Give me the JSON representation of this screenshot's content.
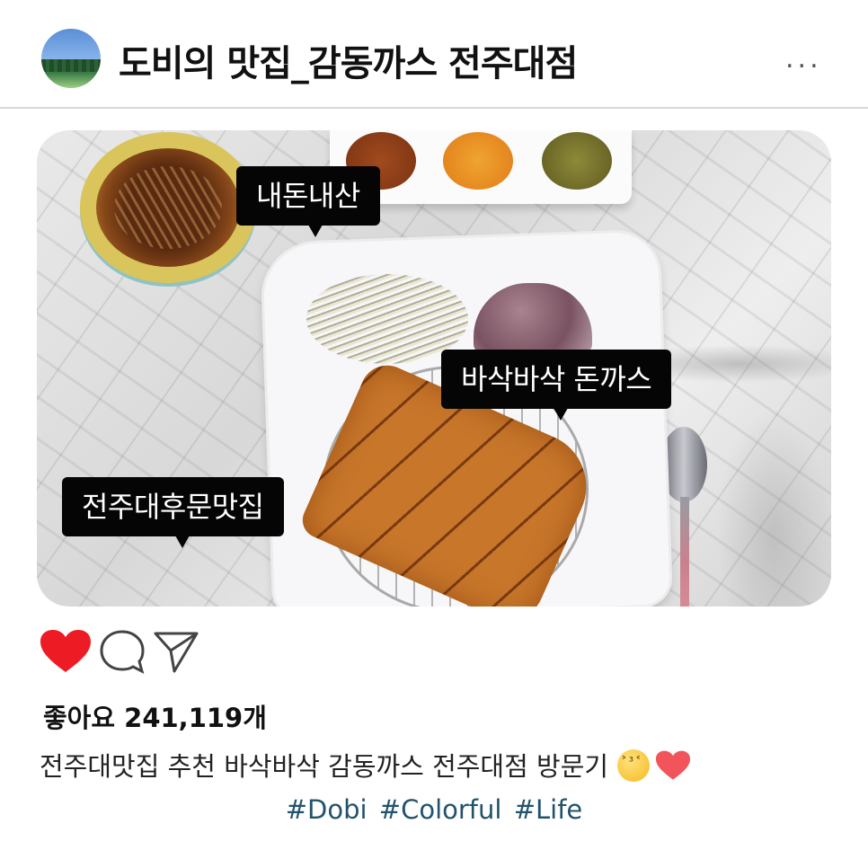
{
  "post": {
    "account_title": "도비의 맛집_감동까스 전주대점",
    "more_label": "...",
    "photo": {
      "tags": {
        "tag1": "내돈내산",
        "tag2": "바삭바삭 돈까스",
        "tag3": "전주대후문맛집"
      }
    },
    "likes_text": "좋아요 241,119개",
    "caption": "전주대맛집 추천 바삭바삭 감동까스 전주대점 방문기",
    "hashtags": [
      "#Dobi",
      "#Colorful",
      "#Life"
    ]
  },
  "icons": {
    "like": "heart-icon",
    "comment": "comment-icon",
    "share": "share-icon",
    "more": "more-icon"
  },
  "colors": {
    "like_red": "#ed1c24",
    "hashtag": "#23536b",
    "tag_bg": "#050505"
  }
}
